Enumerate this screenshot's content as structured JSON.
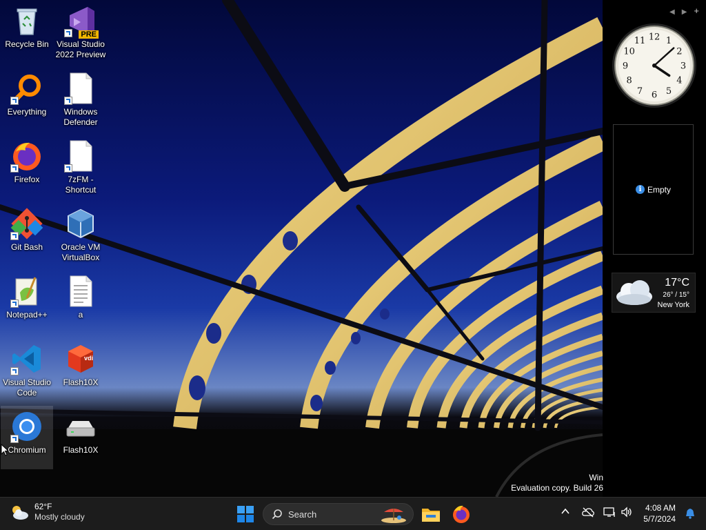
{
  "desktop_icons": [
    {
      "label": "Recycle Bin",
      "icon": "recycle-bin-icon",
      "shortcut": false
    },
    {
      "label": "Visual Studio 2022 Preview",
      "icon": "visual-studio-preview-icon",
      "badge": "PRE",
      "shortcut": true
    },
    {
      "label": "Everything",
      "icon": "everything-icon",
      "shortcut": true
    },
    {
      "label": "Windows Defender",
      "icon": "file-icon",
      "shortcut": true
    },
    {
      "label": "Firefox",
      "icon": "firefox-icon",
      "shortcut": true
    },
    {
      "label": "7zFM - Shortcut",
      "icon": "file-icon",
      "shortcut": true
    },
    {
      "label": "Git Bash",
      "icon": "git-bash-icon",
      "shortcut": true
    },
    {
      "label": "Oracle VM VirtualBox",
      "icon": "virtualbox-icon",
      "shortcut": false
    },
    {
      "label": "Notepad++",
      "icon": "notepadpp-icon",
      "shortcut": true
    },
    {
      "label": "a",
      "icon": "text-file-icon",
      "shortcut": false
    },
    {
      "label": "Visual Studio Code",
      "icon": "vscode-icon",
      "shortcut": true
    },
    {
      "label": "Flash10X",
      "icon": "flash10x-app-icon",
      "badge": "vdi",
      "shortcut": false
    },
    {
      "label": "Chromium",
      "icon": "chromium-icon",
      "shortcut": true,
      "selected": true
    },
    {
      "label": "Flash10X",
      "icon": "drive-icon",
      "shortcut": false
    }
  ],
  "gadgets": {
    "clock": {
      "numbers": [
        "12",
        "1",
        "2",
        "3",
        "4",
        "5",
        "6",
        "7",
        "8",
        "9",
        "10",
        "11"
      ],
      "hour": 4,
      "minute": 8
    },
    "slideshow": {
      "text": "Empty"
    },
    "weather": {
      "temp": "17°C",
      "range": "26° / 15°",
      "city": "New York"
    }
  },
  "watermark": {
    "line1": "Win",
    "line2": "Evaluation copy. Build 26"
  },
  "taskbar": {
    "weather": {
      "temp": "62°F",
      "condition": "Mostly cloudy"
    },
    "search": {
      "label": "Search"
    },
    "clock": {
      "time": "4:08 AM",
      "date": "5/7/2024"
    }
  },
  "colors": {
    "taskbar_bg": "#1c1c1c",
    "accent": "#3a8ee6",
    "windows_blue": "#1e90ff"
  }
}
